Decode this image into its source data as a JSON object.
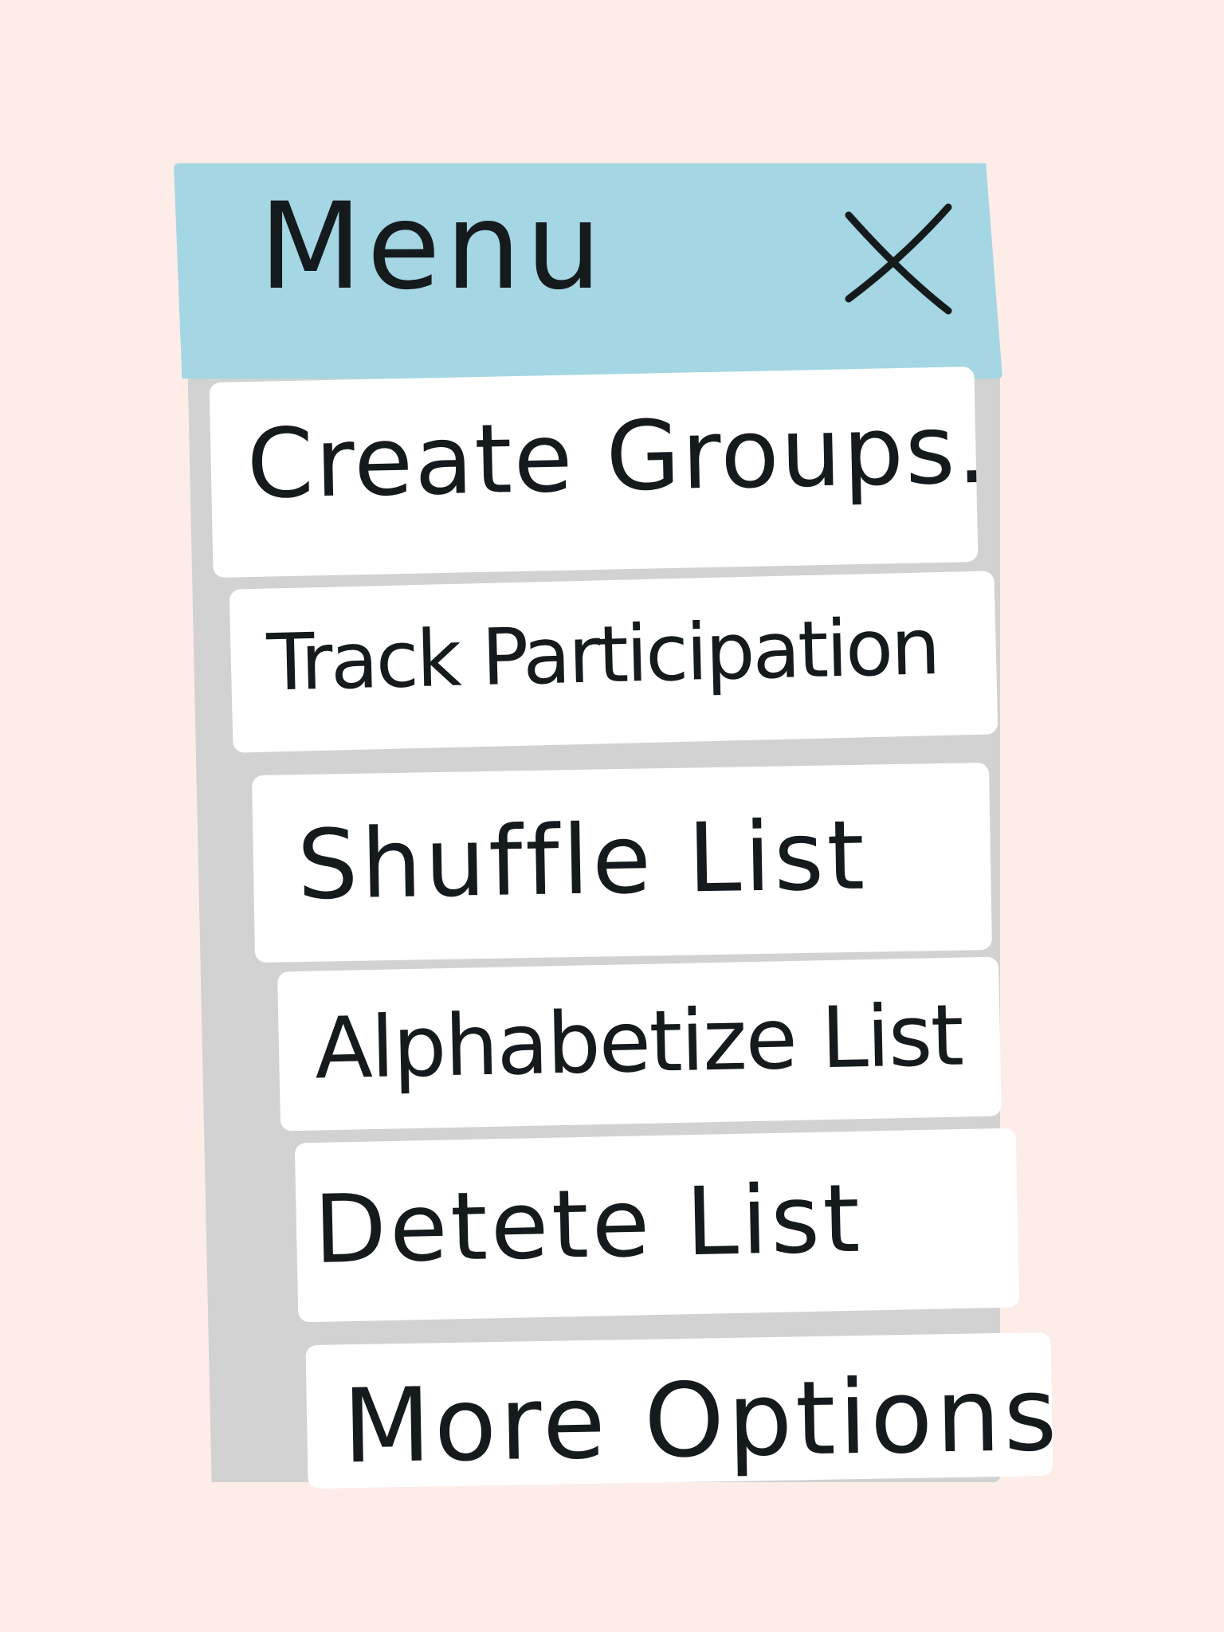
{
  "menu": {
    "title": "Menu",
    "close_icon": "close-icon",
    "items": [
      {
        "label": "Create Groups..."
      },
      {
        "label": "Track Participation"
      },
      {
        "label": "Shuffle List"
      },
      {
        "label": "Alphabetize List"
      },
      {
        "label": "Detete List"
      },
      {
        "label": "More Options..."
      }
    ]
  },
  "colors": {
    "background": "#fdece8",
    "header": "#a4d6e3",
    "panel": "#d2d2d2",
    "item": "#ffffff",
    "ink": "#151a1d"
  }
}
